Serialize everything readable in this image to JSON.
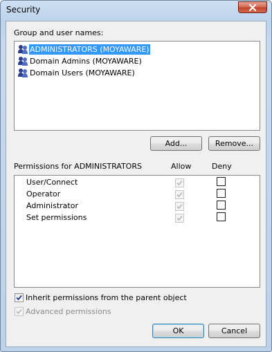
{
  "window": {
    "title": "Security"
  },
  "users": {
    "label": "Group and user names:",
    "items": [
      {
        "name": "ADMINISTRATORS (MOYAWARE)",
        "selected": true
      },
      {
        "name": "Domain Admins (MOYAWARE)",
        "selected": false
      },
      {
        "name": "Domain Users (MOYAWARE)",
        "selected": false
      }
    ]
  },
  "buttons": {
    "add": "Add...",
    "remove": "Remove...",
    "ok": "OK",
    "cancel": "Cancel"
  },
  "permissions": {
    "label": "Permissions for ADMINISTRATORS",
    "allow_header": "Allow",
    "deny_header": "Deny",
    "rows": [
      {
        "name": "User/Connect",
        "allow": true,
        "deny": false
      },
      {
        "name": "Operator",
        "allow": true,
        "deny": false
      },
      {
        "name": "Administrator",
        "allow": true,
        "deny": false
      },
      {
        "name": "Set permissions",
        "allow": true,
        "deny": false
      }
    ]
  },
  "options": {
    "inherit": {
      "label": "Inherit permissions from the parent object",
      "checked": true,
      "enabled": true
    },
    "advanced": {
      "label": "Advanced permissions",
      "checked": true,
      "enabled": false
    }
  },
  "icons": {
    "close": "close-icon",
    "user": "user-group-icon",
    "check": "checkmark-icon"
  }
}
